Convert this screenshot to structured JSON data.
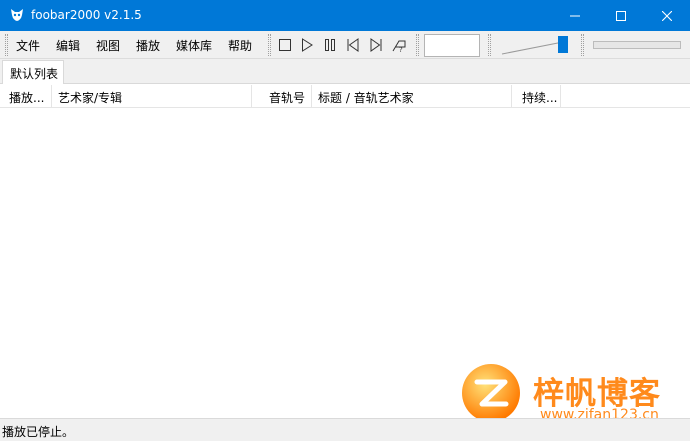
{
  "window": {
    "title": "foobar2000 v2.1.5",
    "accent_color": "#0078d7",
    "controls": [
      "minimize-icon",
      "maximize-icon",
      "close-icon"
    ]
  },
  "menu": {
    "items": [
      "文件",
      "编辑",
      "视图",
      "播放",
      "媒体库",
      "帮助"
    ]
  },
  "playback_buttons": [
    "stop-icon",
    "play-icon",
    "pause-icon",
    "previous-icon",
    "next-icon",
    "random-icon"
  ],
  "volume_level": 1.0,
  "playlist_tabs": [
    "默认列表"
  ],
  "columns": [
    "播放...",
    "艺术家/专辑",
    "音轨号",
    "标题 / 音轨艺术家",
    "持续..."
  ],
  "rows": [],
  "status": {
    "text": "播放已停止。"
  },
  "watermark": {
    "name": "梓帆博客",
    "url": "www.zifan123.cn",
    "color": "#ff8a1c"
  }
}
